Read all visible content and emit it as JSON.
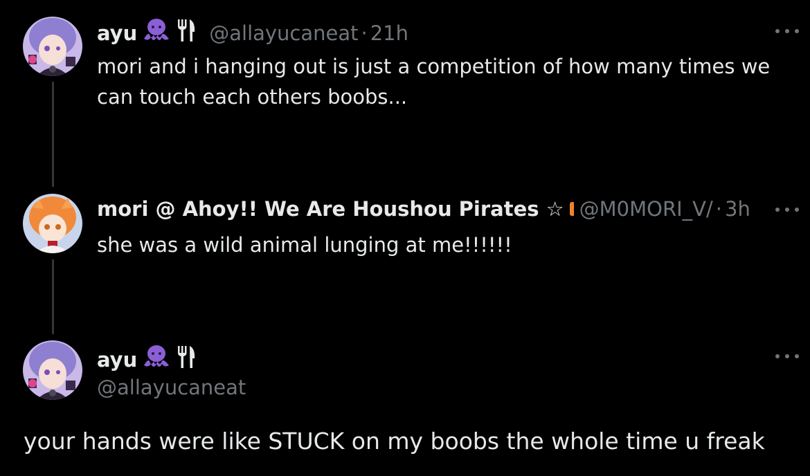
{
  "tweets": [
    {
      "name": "ayu",
      "handle": "@allayucaneat",
      "separator": "·",
      "time": "21h",
      "text": "mori and i hanging out is just a competition of how many times we can touch each others boobs..."
    },
    {
      "name": "mori @ Ahoy!! We Are Houshou Pirates ☆",
      "handle": "@M0MORI_V/",
      "separator": "·",
      "time": "3h",
      "text": "she was a wild animal lunging at me!!!!!!"
    }
  ],
  "main_tweet": {
    "name": "ayu",
    "handle": "@allayucaneat",
    "text": "your hands were like STUCK on my boobs the whole time u freak"
  },
  "icons": {
    "octopus": "octopus-icon",
    "fork_knife": "fork-and-knife-icon",
    "more": "more-icon"
  },
  "colors": {
    "background": "#000000",
    "text": "#e7e9ea",
    "secondary": "#71767b",
    "octopus": "#8b5fd6"
  }
}
